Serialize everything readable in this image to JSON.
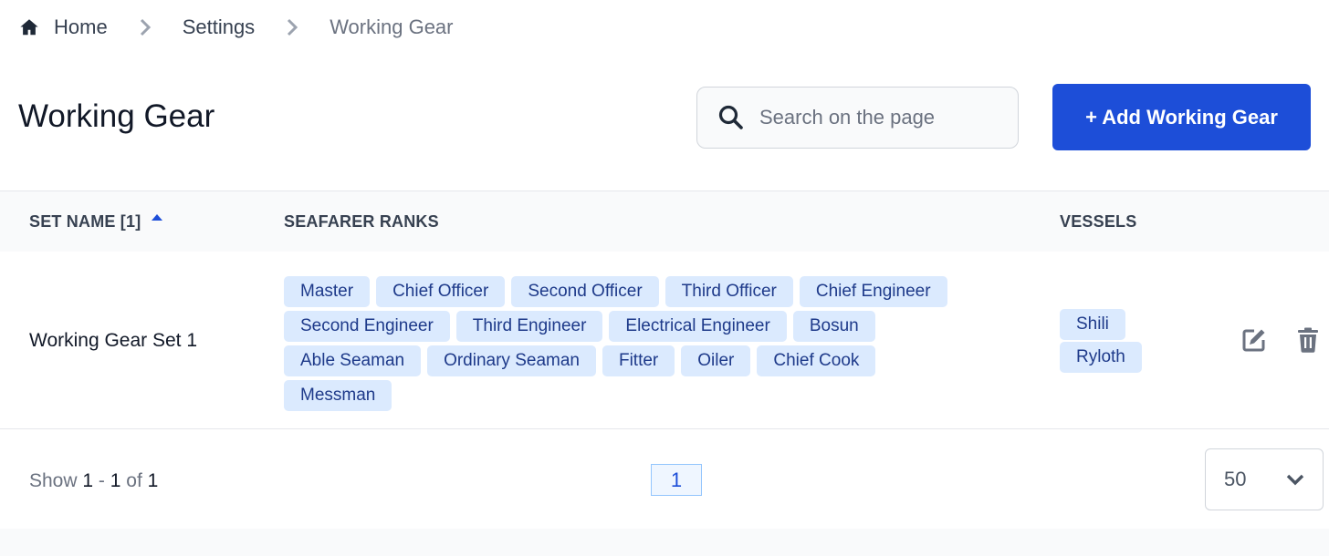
{
  "breadcrumb": {
    "icon": "home-icon",
    "items": [
      "Home",
      "Settings",
      "Working Gear"
    ]
  },
  "header": {
    "title": "Working Gear",
    "search_placeholder": "Search on the page",
    "search_value": "",
    "add_button_label": "+ Add Working Gear"
  },
  "table": {
    "columns": [
      "SET NAME [1]",
      "SEAFARER RANKS",
      "VESSELS"
    ],
    "sort": {
      "column": "SET NAME [1]",
      "direction": "ascending",
      "icon": "sort-up-icon"
    },
    "rows": [
      {
        "set_name": "Working Gear Set 1",
        "ranks": [
          "Master",
          "Chief Officer",
          "Second Officer",
          "Third Officer",
          "Chief Engineer",
          "Second Engineer",
          "Third Engineer",
          "Electrical Engineer",
          "Bosun",
          "Able Seaman",
          "Ordinary Seaman",
          "Fitter",
          "Oiler",
          "Chief Cook",
          "Messman"
        ],
        "vessels": [
          "Shili",
          "Ryloth"
        ],
        "actions": [
          "edit-icon",
          "trash-icon"
        ]
      }
    ]
  },
  "footer": {
    "show_prefix": "Show",
    "range_start": "1",
    "range_sep": "-",
    "range_end": "1",
    "of_label": "of",
    "total": "1",
    "current_page": "1",
    "page_size": "50"
  },
  "colors": {
    "accent": "#1d4ed8",
    "tag_bg": "#dbeafe",
    "tag_text": "#1e3a8a"
  }
}
